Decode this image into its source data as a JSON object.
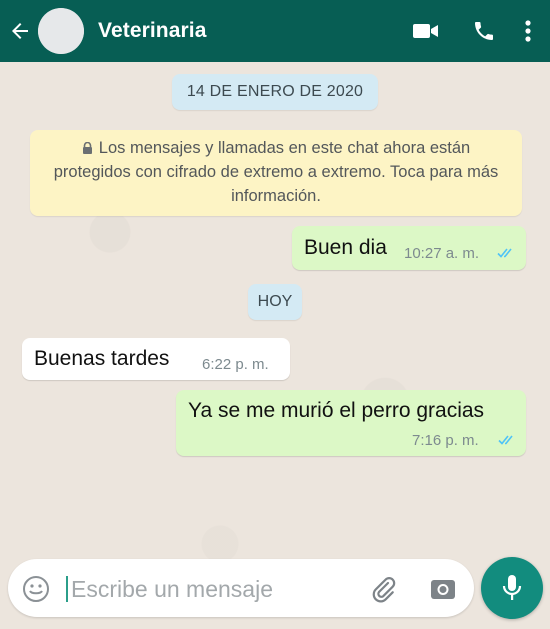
{
  "header": {
    "contact_name": "Veterinaria",
    "icons": [
      "back-arrow-icon",
      "avatar-placeholder",
      "video-call-icon",
      "phone-icon",
      "more-options-icon"
    ]
  },
  "chat": {
    "date_chip": "14 DE ENERO DE 2020",
    "encryption_notice": "Los mensajes y llamadas en este chat ahora están protegidos con cifrado de extremo a extremo. Toca para más información.",
    "today_chip": "HOY",
    "messages": [
      {
        "direction": "outgoing",
        "text": "Buen dia",
        "time": "10:27 a. m.",
        "read": true
      },
      {
        "direction": "incoming",
        "text": "Buenas tardes",
        "time": "6:22 p. m."
      },
      {
        "direction": "outgoing",
        "text": "Ya se me murió el perro gracias",
        "time": "7:16 p. m.",
        "read": true
      }
    ]
  },
  "composer": {
    "placeholder": "Escribe un mensaje"
  },
  "colors": {
    "header": "#075e54",
    "outgoing_bubble": "#dcf8c6",
    "incoming_bubble": "#ffffff",
    "system_notice": "#fdf4c5",
    "date_chip": "#d4eaf4",
    "mic_button": "#128c7e",
    "read_ticks": "#4fc3f7"
  }
}
